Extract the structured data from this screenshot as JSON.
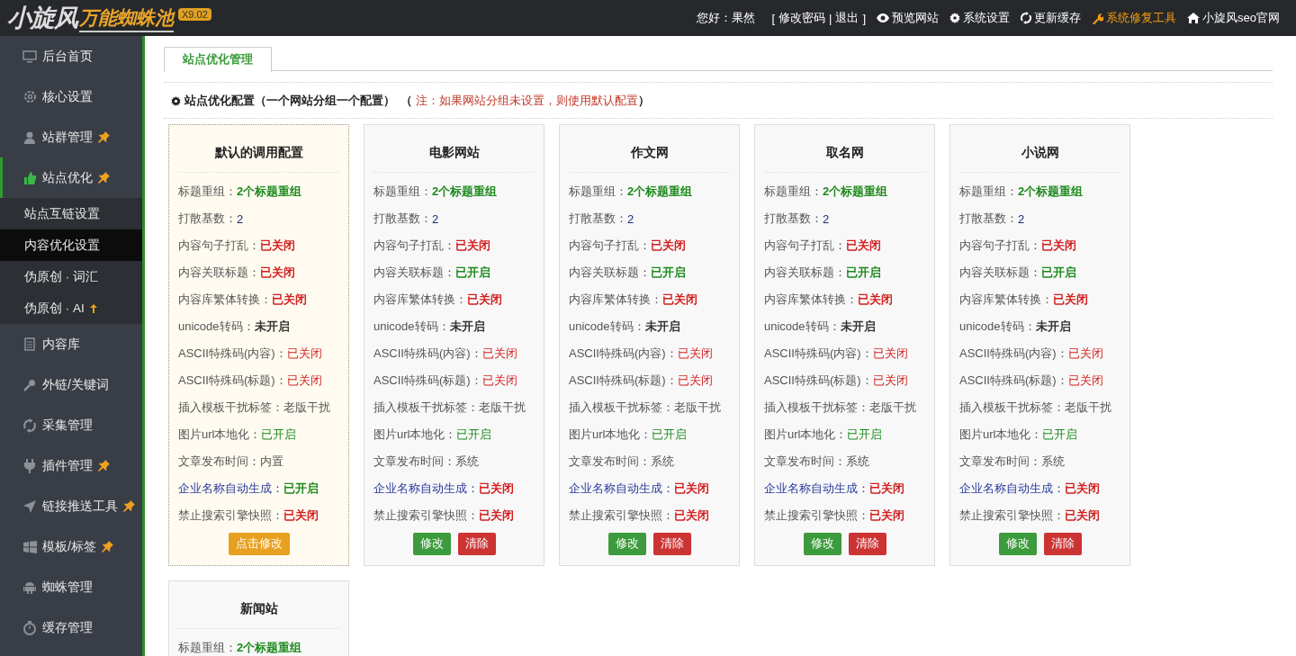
{
  "header": {
    "logo": {
      "main": "小旋风",
      "sub": "万能蜘蛛池",
      "version": "X9.02"
    },
    "greeting": "您好：果然",
    "account": {
      "open": "[",
      "links": [
        "修改密码",
        "退出"
      ],
      "separator": "|",
      "close": "]"
    },
    "nav": [
      {
        "label": "预览网站",
        "highlight": false
      },
      {
        "label": "系统设置",
        "highlight": false
      },
      {
        "label": "更新缓存",
        "highlight": false
      },
      {
        "label": "系统修复工具",
        "highlight": true
      },
      {
        "label": "小旋风seo官网",
        "highlight": false
      }
    ]
  },
  "sidebar": {
    "items": [
      {
        "label": "后台首页",
        "selected": false,
        "pinned": false
      },
      {
        "label": "核心设置",
        "selected": false,
        "pinned": false
      },
      {
        "label": "站群管理",
        "selected": false,
        "pinned": true
      },
      {
        "label": "站点优化",
        "selected": true,
        "pinned": true,
        "expanded": true,
        "children": [
          {
            "label": "站点互链设置",
            "selected": false,
            "arrow": false
          },
          {
            "label": "内容优化设置",
            "selected": true,
            "arrow": false
          },
          {
            "label": "伪原创 · 词汇",
            "selected": false,
            "arrow": false
          },
          {
            "label": "伪原创 · AI",
            "selected": false,
            "arrow": true
          }
        ]
      },
      {
        "label": "内容库",
        "selected": false,
        "pinned": false
      },
      {
        "label": "外链/关键词",
        "selected": false,
        "pinned": false
      },
      {
        "label": "采集管理",
        "selected": false,
        "pinned": false
      },
      {
        "label": "插件管理",
        "selected": false,
        "pinned": true
      },
      {
        "label": "链接推送工具",
        "selected": false,
        "pinned": true
      },
      {
        "label": "模板/标签",
        "selected": false,
        "pinned": true
      },
      {
        "label": "蜘蛛管理",
        "selected": false,
        "pinned": false
      },
      {
        "label": "缓存管理",
        "selected": false,
        "pinned": false
      }
    ]
  },
  "tabs": [
    {
      "label": "站点优化管理",
      "selected": true
    }
  ],
  "section": {
    "title": "站点优化配置（一个网站分组一个配置）",
    "open": "（",
    "note": "注：如果网站分组未设置，则使用默认配置",
    "close": "）"
  },
  "cards": [
    {
      "title": "默认的调用配置",
      "highlighted": true,
      "rows": [
        {
          "label": "标题重组：",
          "value": "2个标题重组",
          "color": "#1e8a1e",
          "bold": true,
          "link": false
        },
        {
          "label": "打散基数：",
          "value": "2",
          "color": "#1c2a78",
          "bold": false,
          "link": false
        },
        {
          "label": "内容句子打乱：",
          "value": "已关闭",
          "color": "#d21f1f",
          "bold": true,
          "link": false
        },
        {
          "label": "内容关联标题：",
          "value": "已关闭",
          "color": "#d21f1f",
          "bold": true,
          "link": false
        },
        {
          "label": "内容库繁体转换：",
          "value": "已关闭",
          "color": "#d21f1f",
          "bold": true,
          "link": false
        },
        {
          "label": "unicode转码：",
          "value": "未开启",
          "color": "#333333",
          "bold": true,
          "link": false
        },
        {
          "label": "ASCII特殊码(内容)：",
          "value": "已关闭",
          "color": "#d21f1f",
          "bold": false,
          "link": false
        },
        {
          "label": "ASCII特殊码(标题)：",
          "value": "已关闭",
          "color": "#d21f1f",
          "bold": false,
          "link": false
        },
        {
          "label": "插入模板干扰标签：",
          "value": "老版干扰",
          "color": "#555555",
          "bold": false,
          "link": false
        },
        {
          "label": "图片url本地化：",
          "value": "已开启",
          "color": "#1e8a1e",
          "bold": false,
          "link": false
        },
        {
          "label": "文章发布时间：",
          "value": "内置",
          "color": "#555555",
          "bold": false,
          "link": false
        },
        {
          "label": "企业名称自动生成：",
          "value": "已开启",
          "color": "#1e8a1e",
          "bold": true,
          "link": true
        },
        {
          "label": "禁止搜索引擎快照：",
          "value": "已关闭",
          "color": "#d21f1f",
          "bold": true,
          "link": false
        }
      ],
      "buttons": [
        {
          "label": "点击修改",
          "color": "#e8a020"
        }
      ]
    },
    {
      "title": "电影网站",
      "highlighted": false,
      "rows": [
        {
          "label": "标题重组：",
          "value": "2个标题重组",
          "color": "#1e8a1e",
          "bold": true,
          "link": false
        },
        {
          "label": "打散基数：",
          "value": "2",
          "color": "#1c2a78",
          "bold": false,
          "link": false
        },
        {
          "label": "内容句子打乱：",
          "value": "已关闭",
          "color": "#d21f1f",
          "bold": true,
          "link": false
        },
        {
          "label": "内容关联标题：",
          "value": "已开启",
          "color": "#1e8a1e",
          "bold": true,
          "link": false
        },
        {
          "label": "内容库繁体转换：",
          "value": "已关闭",
          "color": "#d21f1f",
          "bold": true,
          "link": false
        },
        {
          "label": "unicode转码：",
          "value": "未开启",
          "color": "#333333",
          "bold": true,
          "link": false
        },
        {
          "label": "ASCII特殊码(内容)：",
          "value": "已关闭",
          "color": "#d21f1f",
          "bold": false,
          "link": false
        },
        {
          "label": "ASCII特殊码(标题)：",
          "value": "已关闭",
          "color": "#d21f1f",
          "bold": false,
          "link": false
        },
        {
          "label": "插入模板干扰标签：",
          "value": "老版干扰",
          "color": "#555555",
          "bold": false,
          "link": false
        },
        {
          "label": "图片url本地化：",
          "value": "已开启",
          "color": "#1e8a1e",
          "bold": false,
          "link": false
        },
        {
          "label": "文章发布时间：",
          "value": "系统",
          "color": "#555555",
          "bold": false,
          "link": false
        },
        {
          "label": "企业名称自动生成：",
          "value": "已关闭",
          "color": "#d21f1f",
          "bold": true,
          "link": true
        },
        {
          "label": "禁止搜索引擎快照：",
          "value": "已关闭",
          "color": "#d21f1f",
          "bold": true,
          "link": false
        }
      ],
      "buttons": [
        {
          "label": "修改",
          "color": "#3c9b3c"
        },
        {
          "label": "清除",
          "color": "#cc3333"
        }
      ]
    },
    {
      "title": "作文网",
      "highlighted": false,
      "rows": [
        {
          "label": "标题重组：",
          "value": "2个标题重组",
          "color": "#1e8a1e",
          "bold": true,
          "link": false
        },
        {
          "label": "打散基数：",
          "value": "2",
          "color": "#1c2a78",
          "bold": false,
          "link": false
        },
        {
          "label": "内容句子打乱：",
          "value": "已关闭",
          "color": "#d21f1f",
          "bold": true,
          "link": false
        },
        {
          "label": "内容关联标题：",
          "value": "已开启",
          "color": "#1e8a1e",
          "bold": true,
          "link": false
        },
        {
          "label": "内容库繁体转换：",
          "value": "已关闭",
          "color": "#d21f1f",
          "bold": true,
          "link": false
        },
        {
          "label": "unicode转码：",
          "value": "未开启",
          "color": "#333333",
          "bold": true,
          "link": false
        },
        {
          "label": "ASCII特殊码(内容)：",
          "value": "已关闭",
          "color": "#d21f1f",
          "bold": false,
          "link": false
        },
        {
          "label": "ASCII特殊码(标题)：",
          "value": "已关闭",
          "color": "#d21f1f",
          "bold": false,
          "link": false
        },
        {
          "label": "插入模板干扰标签：",
          "value": "老版干扰",
          "color": "#555555",
          "bold": false,
          "link": false
        },
        {
          "label": "图片url本地化：",
          "value": "已开启",
          "color": "#1e8a1e",
          "bold": false,
          "link": false
        },
        {
          "label": "文章发布时间：",
          "value": "系统",
          "color": "#555555",
          "bold": false,
          "link": false
        },
        {
          "label": "企业名称自动生成：",
          "value": "已关闭",
          "color": "#d21f1f",
          "bold": true,
          "link": true
        },
        {
          "label": "禁止搜索引擎快照：",
          "value": "已关闭",
          "color": "#d21f1f",
          "bold": true,
          "link": false
        }
      ],
      "buttons": [
        {
          "label": "修改",
          "color": "#3c9b3c"
        },
        {
          "label": "清除",
          "color": "#cc3333"
        }
      ]
    },
    {
      "title": "取名网",
      "highlighted": false,
      "rows": [
        {
          "label": "标题重组：",
          "value": "2个标题重组",
          "color": "#1e8a1e",
          "bold": true,
          "link": false
        },
        {
          "label": "打散基数：",
          "value": "2",
          "color": "#1c2a78",
          "bold": false,
          "link": false
        },
        {
          "label": "内容句子打乱：",
          "value": "已关闭",
          "color": "#d21f1f",
          "bold": true,
          "link": false
        },
        {
          "label": "内容关联标题：",
          "value": "已开启",
          "color": "#1e8a1e",
          "bold": true,
          "link": false
        },
        {
          "label": "内容库繁体转换：",
          "value": "已关闭",
          "color": "#d21f1f",
          "bold": true,
          "link": false
        },
        {
          "label": "unicode转码：",
          "value": "未开启",
          "color": "#333333",
          "bold": true,
          "link": false
        },
        {
          "label": "ASCII特殊码(内容)：",
          "value": "已关闭",
          "color": "#d21f1f",
          "bold": false,
          "link": false
        },
        {
          "label": "ASCII特殊码(标题)：",
          "value": "已关闭",
          "color": "#d21f1f",
          "bold": false,
          "link": false
        },
        {
          "label": "插入模板干扰标签：",
          "value": "老版干扰",
          "color": "#555555",
          "bold": false,
          "link": false
        },
        {
          "label": "图片url本地化：",
          "value": "已开启",
          "color": "#1e8a1e",
          "bold": false,
          "link": false
        },
        {
          "label": "文章发布时间：",
          "value": "系统",
          "color": "#555555",
          "bold": false,
          "link": false
        },
        {
          "label": "企业名称自动生成：",
          "value": "已关闭",
          "color": "#d21f1f",
          "bold": true,
          "link": true
        },
        {
          "label": "禁止搜索引擎快照：",
          "value": "已关闭",
          "color": "#d21f1f",
          "bold": true,
          "link": false
        }
      ],
      "buttons": [
        {
          "label": "修改",
          "color": "#3c9b3c"
        },
        {
          "label": "清除",
          "color": "#cc3333"
        }
      ]
    },
    {
      "title": "小说网",
      "highlighted": false,
      "rows": [
        {
          "label": "标题重组：",
          "value": "2个标题重组",
          "color": "#1e8a1e",
          "bold": true,
          "link": false
        },
        {
          "label": "打散基数：",
          "value": "2",
          "color": "#1c2a78",
          "bold": false,
          "link": false
        },
        {
          "label": "内容句子打乱：",
          "value": "已关闭",
          "color": "#d21f1f",
          "bold": true,
          "link": false
        },
        {
          "label": "内容关联标题：",
          "value": "已开启",
          "color": "#1e8a1e",
          "bold": true,
          "link": false
        },
        {
          "label": "内容库繁体转换：",
          "value": "已关闭",
          "color": "#d21f1f",
          "bold": true,
          "link": false
        },
        {
          "label": "unicode转码：",
          "value": "未开启",
          "color": "#333333",
          "bold": true,
          "link": false
        },
        {
          "label": "ASCII特殊码(内容)：",
          "value": "已关闭",
          "color": "#d21f1f",
          "bold": false,
          "link": false
        },
        {
          "label": "ASCII特殊码(标题)：",
          "value": "已关闭",
          "color": "#d21f1f",
          "bold": false,
          "link": false
        },
        {
          "label": "插入模板干扰标签：",
          "value": "老版干扰",
          "color": "#555555",
          "bold": false,
          "link": false
        },
        {
          "label": "图片url本地化：",
          "value": "已开启",
          "color": "#1e8a1e",
          "bold": false,
          "link": false
        },
        {
          "label": "文章发布时间：",
          "value": "系统",
          "color": "#555555",
          "bold": false,
          "link": false
        },
        {
          "label": "企业名称自动生成：",
          "value": "已关闭",
          "color": "#d21f1f",
          "bold": true,
          "link": true
        },
        {
          "label": "禁止搜索引擎快照：",
          "value": "已关闭",
          "color": "#d21f1f",
          "bold": true,
          "link": false
        }
      ],
      "buttons": [
        {
          "label": "修改",
          "color": "#3c9b3c"
        },
        {
          "label": "清除",
          "color": "#cc3333"
        }
      ]
    },
    {
      "title": "新闻站",
      "highlighted": false,
      "rows": [
        {
          "label": "标题重组：",
          "value": "2个标题重组",
          "color": "#1e8a1e",
          "bold": true,
          "link": false
        }
      ]
    }
  ]
}
